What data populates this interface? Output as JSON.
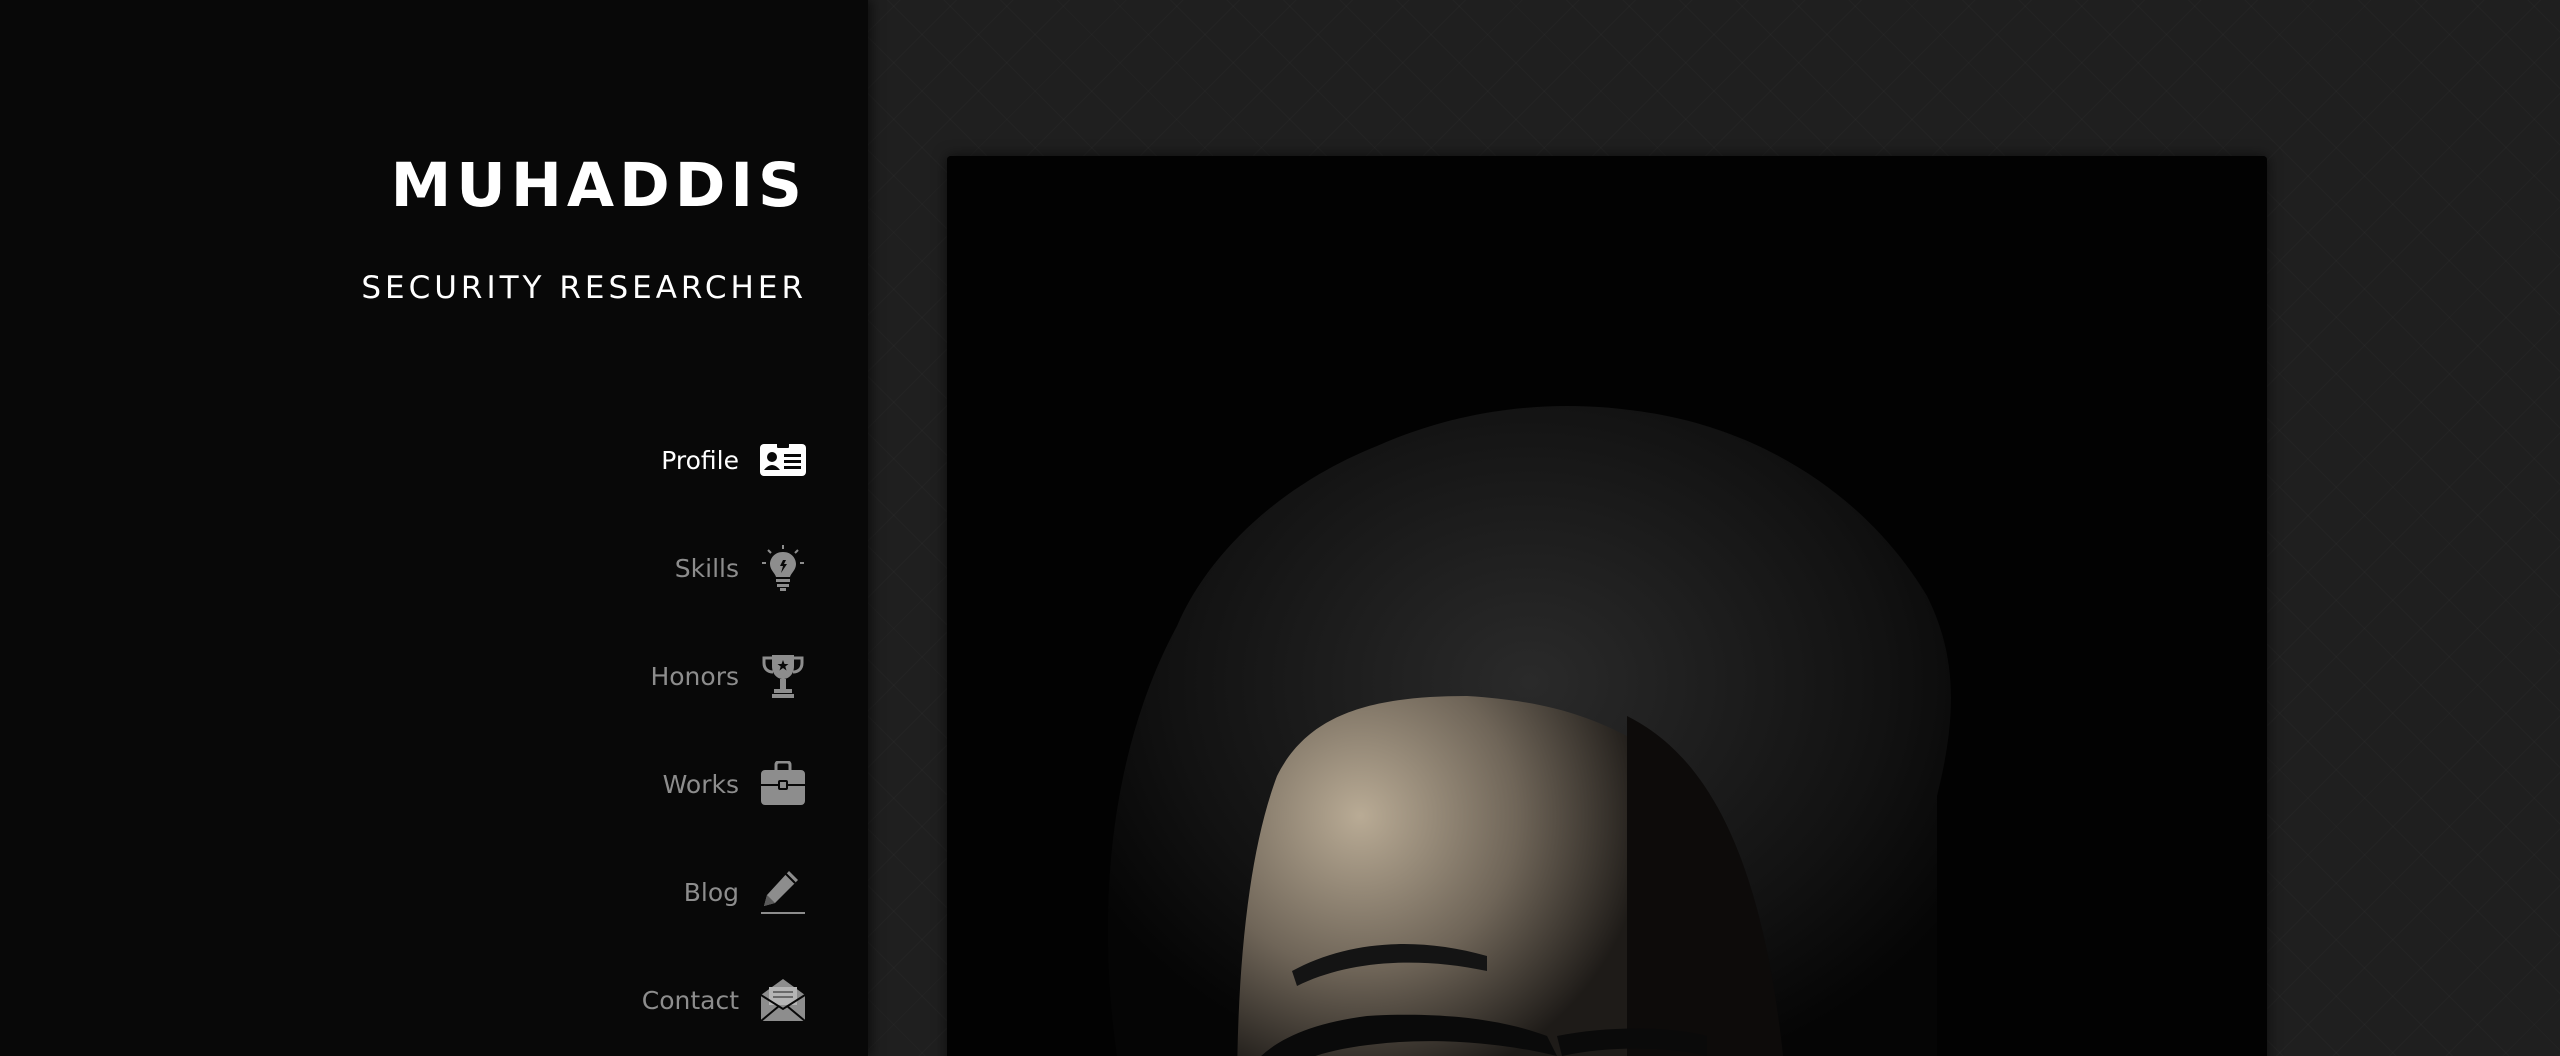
{
  "profile": {
    "name": "MUHADDIS",
    "title": "SECURITY RESEARCHER"
  },
  "nav": {
    "items": [
      {
        "label": "Profile",
        "icon": "id-card-icon",
        "active": true
      },
      {
        "label": "Skills",
        "icon": "lightbulb-icon",
        "active": false
      },
      {
        "label": "Honors",
        "icon": "trophy-icon",
        "active": false
      },
      {
        "label": "Works",
        "icon": "briefcase-icon",
        "active": false
      },
      {
        "label": "Blog",
        "icon": "pencil-icon",
        "active": false
      },
      {
        "label": "Contact",
        "icon": "envelope-icon",
        "active": false
      }
    ]
  },
  "colors": {
    "sidebar_bg": "#080808",
    "main_bg": "#1f1f1f",
    "active_text": "#ffffff",
    "inactive_text": "#8d8d8d"
  }
}
